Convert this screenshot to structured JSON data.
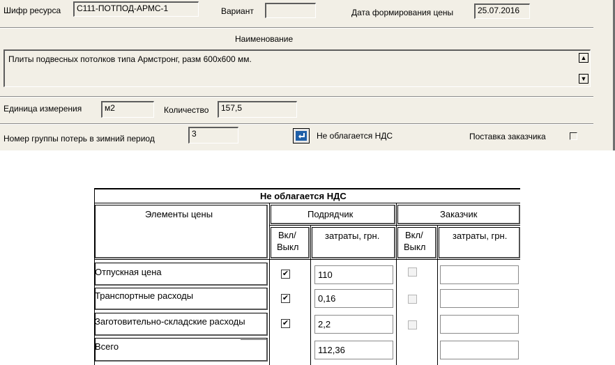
{
  "form": {
    "resource_code_label": "Шифр ресурса",
    "resource_code_value": "С111-ПОТПОД-АРМС-1",
    "variant_label": "Вариант",
    "variant_value": "",
    "price_date_label": "Дата формирования цены",
    "price_date_value": "25.07.2016",
    "name_header": "Наименование",
    "name_value": "Плиты подвесных потолков типа Армстронг, разм 600х600 мм.",
    "scroll_up": "▲",
    "scroll_down": "▼",
    "unit_label": "Единица измерения",
    "unit_value": "м2",
    "quantity_label": "Количество",
    "quantity_value": "157,5",
    "winter_group_label": "Номер группы потерь в зимний период",
    "winter_group_value": "3",
    "vat_label": "Не облагается НДС",
    "customer_supply_label": "Поставка заказчика",
    "customer_supply_checked": false
  },
  "table": {
    "title": "Не облагается НДС",
    "col_elements": "Элементы цены",
    "col_contractor": "Подрядчик",
    "col_customer": "Заказчик",
    "onoff_line1": "Вкл/",
    "onoff_line2": "Выкл",
    "costs_label": "затраты, грн.",
    "rows": [
      {
        "label": "Отпускная цена",
        "contractor_on": true,
        "contractor_cost": "110",
        "customer_on": false,
        "customer_cost": ""
      },
      {
        "label": "Транспортные расходы",
        "contractor_on": true,
        "contractor_cost": "0,16",
        "customer_on": false,
        "customer_cost": ""
      },
      {
        "label": "Заготовительно-складские расходы",
        "contractor_on": true,
        "contractor_cost": "2,2",
        "customer_on": false,
        "customer_cost": ""
      }
    ],
    "total_label": "Всего",
    "total_contractor_cost": "112,36",
    "total_customer_cost": "",
    "check_mark": "✔"
  }
}
